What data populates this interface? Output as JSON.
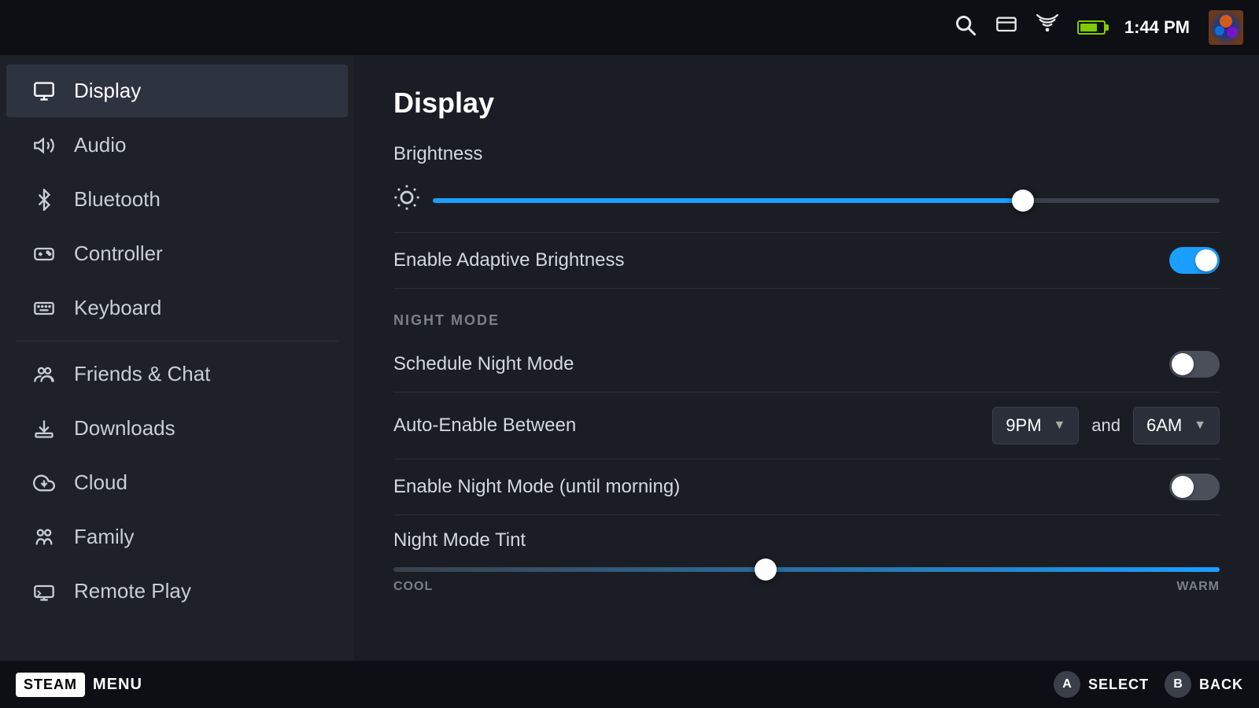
{
  "topbar": {
    "time": "1:44 PM",
    "icons": {
      "search": "🔍",
      "cards": "🃏",
      "signal": "📶"
    }
  },
  "sidebar": {
    "items": [
      {
        "id": "display",
        "label": "Display",
        "icon": "display",
        "active": true
      },
      {
        "id": "audio",
        "label": "Audio",
        "icon": "audio",
        "active": false
      },
      {
        "id": "bluetooth",
        "label": "Bluetooth",
        "icon": "bluetooth",
        "active": false
      },
      {
        "id": "controller",
        "label": "Controller",
        "icon": "controller",
        "active": false
      },
      {
        "id": "keyboard",
        "label": "Keyboard",
        "icon": "keyboard",
        "active": false
      },
      {
        "id": "friends",
        "label": "Friends & Chat",
        "icon": "friends",
        "active": false
      },
      {
        "id": "downloads",
        "label": "Downloads",
        "icon": "downloads",
        "active": false
      },
      {
        "id": "cloud",
        "label": "Cloud",
        "icon": "cloud",
        "active": false
      },
      {
        "id": "family",
        "label": "Family",
        "icon": "family",
        "active": false
      },
      {
        "id": "remoteplay",
        "label": "Remote Play",
        "icon": "remoteplay",
        "active": false
      }
    ]
  },
  "content": {
    "title": "Display",
    "brightness": {
      "label": "Brightness",
      "value": 75,
      "fill_percent": 75
    },
    "adaptive_brightness": {
      "label": "Enable Adaptive Brightness",
      "enabled": true
    },
    "night_mode_section": "NIGHT MODE",
    "schedule_night_mode": {
      "label": "Schedule Night Mode",
      "enabled": false
    },
    "auto_enable": {
      "label": "Auto-Enable Between",
      "start": "9PM",
      "and_label": "and",
      "end": "6AM"
    },
    "enable_night_mode": {
      "label": "Enable Night Mode (until morning)",
      "enabled": false
    },
    "night_mode_tint": {
      "label": "Night Mode Tint",
      "value": 45,
      "fill_percent": 45,
      "cool_label": "COOL",
      "warm_label": "WARM"
    }
  },
  "bottombar": {
    "steam_label": "STEAM",
    "menu_label": "MENU",
    "select_button": "A",
    "select_label": "SELECT",
    "back_button": "B",
    "back_label": "BACK"
  }
}
